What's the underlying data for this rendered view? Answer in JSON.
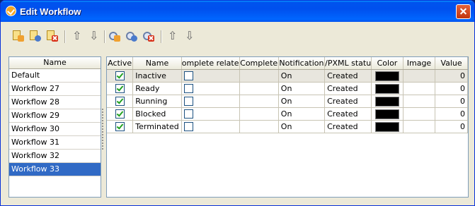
{
  "window": {
    "title": "Edit Workflow"
  },
  "toolbar": {
    "buttons": [
      {
        "name": "new-workflow-icon"
      },
      {
        "name": "edit-workflow-icon"
      },
      {
        "name": "delete-workflow-icon"
      },
      {
        "name": "move-up-icon"
      },
      {
        "name": "move-down-icon"
      },
      {
        "name": "new-status-icon"
      },
      {
        "name": "edit-status-icon"
      },
      {
        "name": "delete-status-icon"
      },
      {
        "name": "status-up-icon"
      },
      {
        "name": "status-down-icon"
      }
    ]
  },
  "workflows": {
    "header": "Name",
    "items": [
      "Default",
      "Workflow 27",
      "Workflow 28",
      "Workflow 29",
      "Workflow 30",
      "Workflow 31",
      "Workflow 32",
      "Workflow 33"
    ],
    "selected": "Workflow 33"
  },
  "statuses": {
    "columns": [
      "Active",
      "Name",
      "omplete relate",
      "Complete",
      "Notification",
      "/PXML statu",
      "Color",
      "Image",
      "Value"
    ],
    "rows": [
      {
        "active": true,
        "name": "Inactive",
        "complete_related": false,
        "complete": "",
        "notification": "On",
        "status": "Created",
        "color": "#000000",
        "image": "",
        "value": "0"
      },
      {
        "active": true,
        "name": "Ready",
        "complete_related": false,
        "complete": "",
        "notification": "On",
        "status": "Created",
        "color": "#000000",
        "image": "",
        "value": "0"
      },
      {
        "active": true,
        "name": "Running",
        "complete_related": false,
        "complete": "",
        "notification": "On",
        "status": "Created",
        "color": "#000000",
        "image": "",
        "value": "0"
      },
      {
        "active": true,
        "name": "Blocked",
        "complete_related": false,
        "complete": "",
        "notification": "On",
        "status": "Created",
        "color": "#000000",
        "image": "",
        "value": "0"
      },
      {
        "active": true,
        "name": "Terminated",
        "complete_related": false,
        "complete": "",
        "notification": "On",
        "status": "Created",
        "color": "#000000",
        "image": "",
        "value": "0"
      }
    ]
  }
}
